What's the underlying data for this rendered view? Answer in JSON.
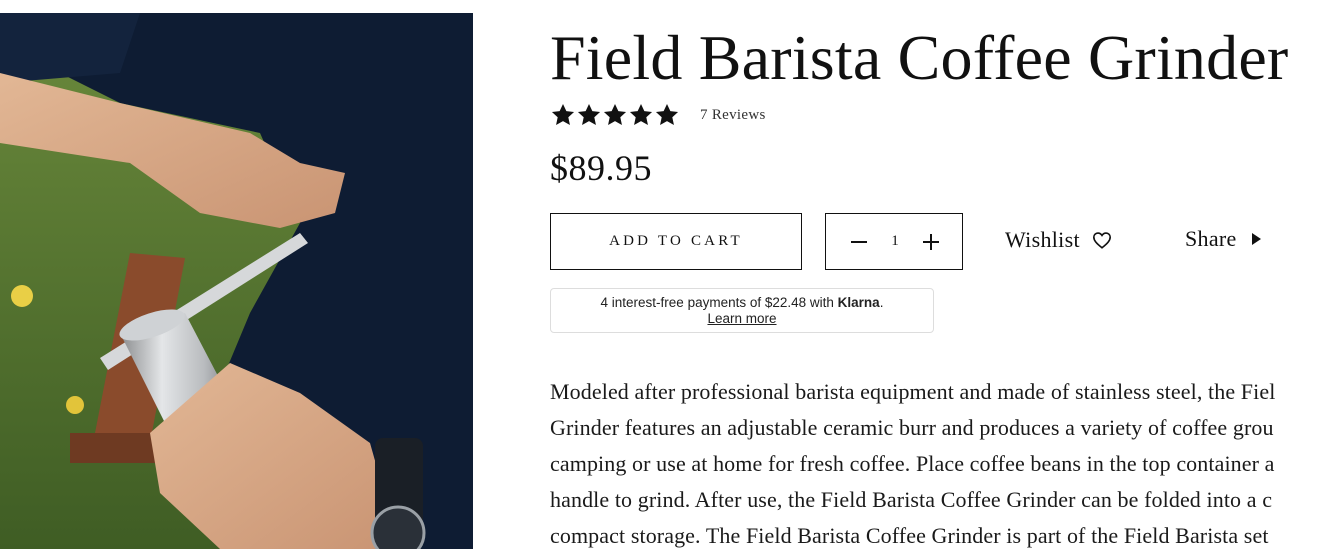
{
  "product": {
    "title": "Field Barista Coffee Grinder",
    "rating": 5,
    "rating_max": 5,
    "reviews_label": "7 Reviews",
    "price": "$89.95"
  },
  "actions": {
    "add_to_cart_label": "ADD TO CART",
    "quantity": "1",
    "wishlist_label": "Wishlist",
    "share_label": "Share"
  },
  "klarna": {
    "text": "4 interest-free payments of $22.48 with ",
    "brand": "Klarna",
    "suffix": ".",
    "learn_more": "Learn more"
  },
  "description": {
    "lines": [
      "Modeled after professional barista equipment and made of stainless steel, the Fiel",
      "Grinder features an adjustable ceramic burr and produces a variety of coffee grou",
      "camping or use at home for fresh coffee. Place coffee beans in the top container a",
      "handle to grind. After use, the Field Barista Coffee Grinder can be folded into a c",
      "compact storage. The Field Barista Coffee Grinder is part of the Field Barista set"
    ]
  },
  "icons": {
    "star": "star-icon",
    "heart": "heart-icon",
    "share_arrow": "play-arrow-icon",
    "minus": "minus-icon",
    "plus": "plus-icon"
  },
  "colors": {
    "text": "#111111",
    "border": "#111111",
    "klarna_border": "#dddddd",
    "background": "#ffffff"
  }
}
